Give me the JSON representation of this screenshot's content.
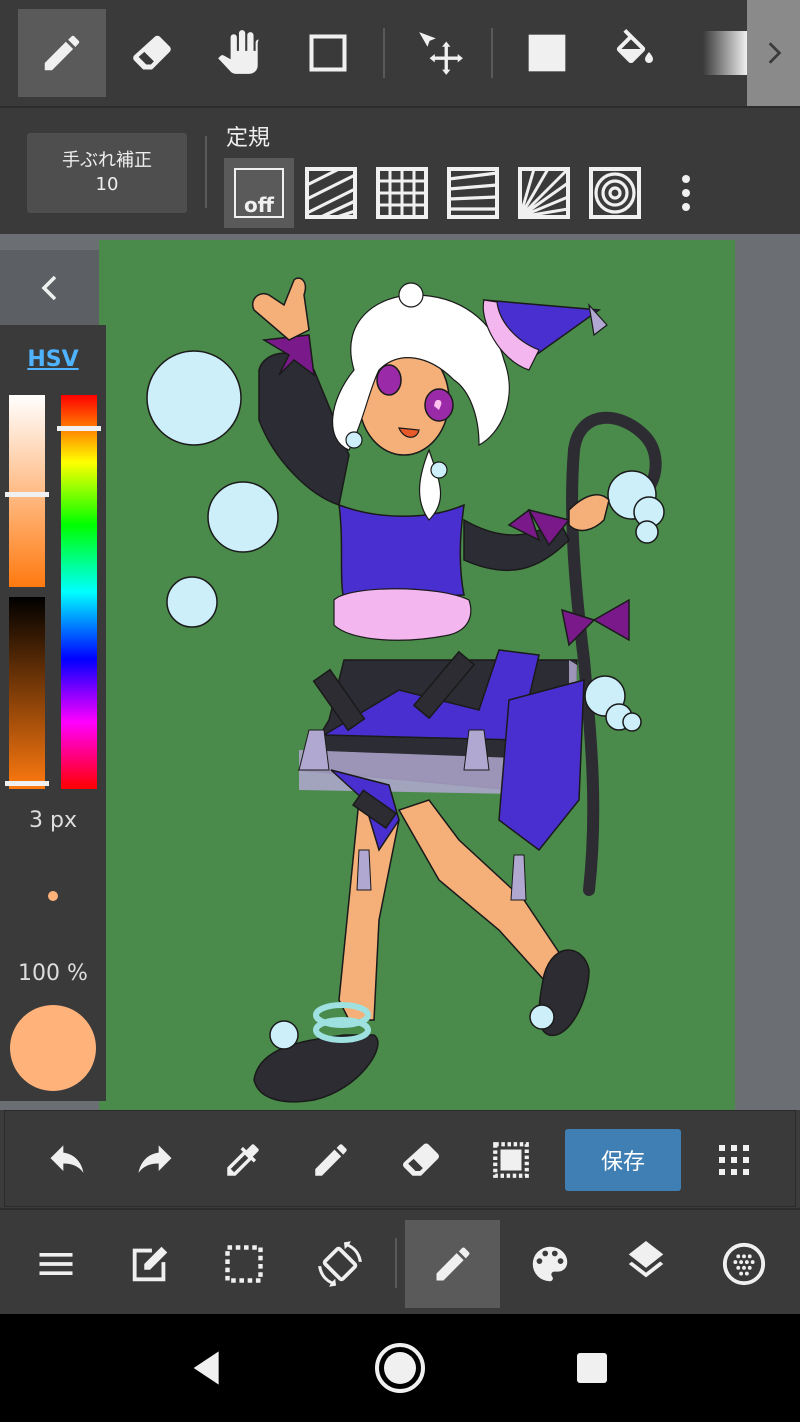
{
  "top_toolbar": {
    "tools": [
      {
        "name": "pencil-icon",
        "active": true
      },
      {
        "name": "eraser-icon"
      },
      {
        "name": "hand-icon"
      },
      {
        "name": "rect-select-icon"
      },
      {
        "name": "move-icon"
      },
      {
        "name": "fill-square-icon"
      },
      {
        "name": "bucket-icon"
      },
      {
        "name": "gradient-icon"
      }
    ],
    "more_icon": "chevron-right-icon"
  },
  "sub_toolbar": {
    "stabilizer_label": "手ぶれ補正",
    "stabilizer_value": "10",
    "ruler_title": "定規",
    "ruler_off_label": "off",
    "rulers": [
      "ruler-off",
      "parallel-ruler-icon",
      "grid-ruler-icon",
      "perspective-ruler-icon",
      "radial-ruler-icon",
      "concentric-ruler-icon",
      "more-vert-icon"
    ]
  },
  "color_panel": {
    "mode_label": "HSV",
    "brush_size": "3 px",
    "opacity": "100 %",
    "current_color": "#ffb27a",
    "saturation_gradient": [
      "#ffffff",
      "#ff7a10"
    ],
    "value_gradient": [
      "#000000",
      "#ff7a10"
    ]
  },
  "canvas": {
    "background": "#4a8a4a"
  },
  "action_bar": {
    "save_label": "保存",
    "actions": [
      "undo-icon",
      "redo-icon",
      "eyedropper-icon",
      "pencil-icon",
      "eraser-icon",
      "select-all-icon",
      "save-button",
      "grid-dots-icon"
    ]
  },
  "bottom_nav": {
    "items": [
      "menu-icon",
      "edit-icon",
      "selection-icon",
      "rotate-icon",
      "pen-tool-icon",
      "palette-icon",
      "layers-icon",
      "material-icon"
    ],
    "active": "pen-tool-icon"
  },
  "system_nav": [
    "back-icon",
    "home-icon",
    "recents-icon"
  ],
  "colors": {
    "accent": "#3f7fb3",
    "toolbar": "#3a3a3a",
    "canvas_bg": "#4a8a4a",
    "hsv_link": "#4fb3ff"
  }
}
